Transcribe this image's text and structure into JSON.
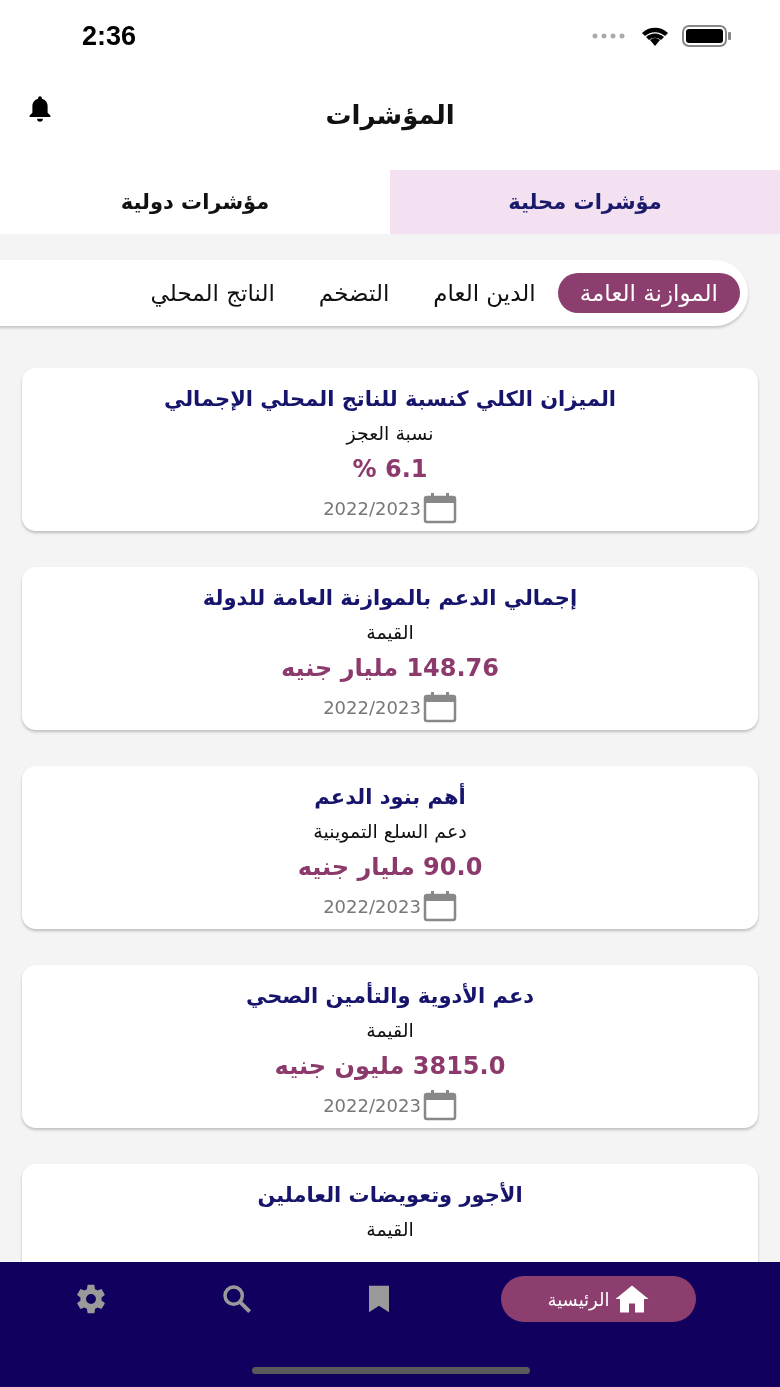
{
  "status_bar": {
    "time": "2:36"
  },
  "header": {
    "title": "المؤشرات"
  },
  "tabs": [
    {
      "label": "مؤشرات محلية",
      "selected": true
    },
    {
      "label": "مؤشرات دولية",
      "selected": false
    }
  ],
  "categories": [
    {
      "label": "الموازنة العامة",
      "selected": true
    },
    {
      "label": "الدين العام",
      "selected": false
    },
    {
      "label": "التضخم",
      "selected": false
    },
    {
      "label": "الناتج المحلي",
      "selected": false
    }
  ],
  "cards": [
    {
      "title": "الميزان الكلي كنسبة للناتج المحلي الإجمالي",
      "subtitle": "نسبة العجز",
      "value": "6.1 %",
      "date": "2022/2023"
    },
    {
      "title": "إجمالي الدعم بالموازنة العامة للدولة",
      "subtitle": "القيمة",
      "value": "148.76 مليار جنيه",
      "date": "2022/2023"
    },
    {
      "title": "أهم بنود الدعم",
      "subtitle": "دعم السلع التموينية",
      "value": "90.0 مليار جنيه",
      "date": "2022/2023"
    },
    {
      "title": "دعم الأدوية والتأمين الصحي",
      "subtitle": "القيمة",
      "value": "3815.0 مليون جنيه",
      "date": "2022/2023"
    },
    {
      "title": "الأجور وتعويضات العاملين",
      "subtitle": "القيمة"
    }
  ],
  "bottom_nav": [
    {
      "kind": "home",
      "label": "الرئيسية",
      "selected": true
    },
    {
      "kind": "bookmark",
      "selected": false
    },
    {
      "kind": "search",
      "selected": false
    },
    {
      "kind": "settings",
      "selected": false
    }
  ]
}
